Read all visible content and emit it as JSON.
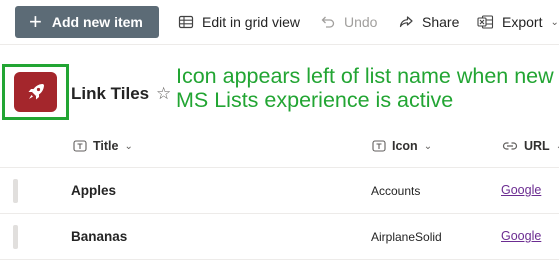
{
  "toolbar": {
    "add_label": "Add new item",
    "grid_label": "Edit in grid view",
    "undo_label": "Undo",
    "share_label": "Share",
    "export_label": "Export"
  },
  "list": {
    "title": "Link Tiles",
    "logo_color": "#a4262c"
  },
  "annotation": {
    "text": "Icon appears left of list name when new MS Lists experience is active",
    "color": "#22a533"
  },
  "columns": [
    {
      "label": "Title"
    },
    {
      "label": "Icon"
    },
    {
      "label": "URL"
    }
  ],
  "rows": [
    {
      "title": "Apples",
      "icon": "Accounts",
      "url": "Google"
    },
    {
      "title": "Bananas",
      "icon": "AirplaneSolid",
      "url": "Google"
    }
  ],
  "colors": {
    "primary_button": "#5c6b76",
    "link": "#6b2c91"
  }
}
